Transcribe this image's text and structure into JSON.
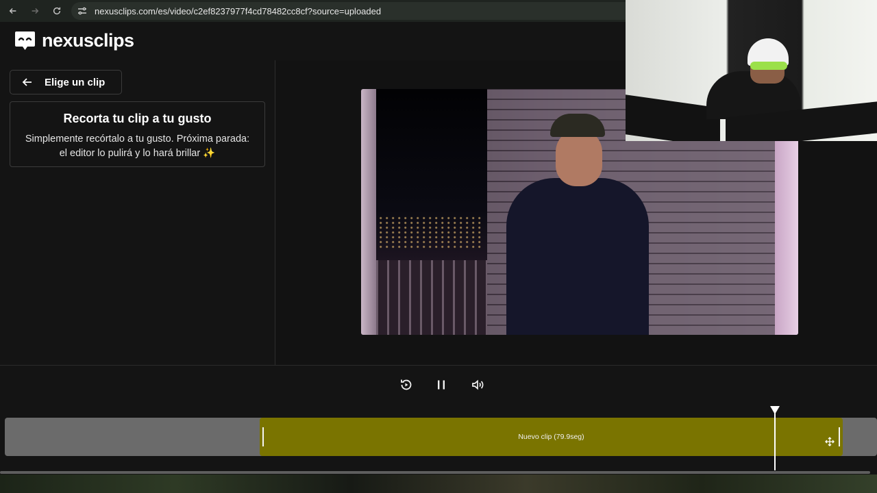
{
  "browser": {
    "url": "nexusclips.com/es/video/c2ef8237977f4cd78482cc8cf?source=uploaded"
  },
  "header": {
    "brand": "nexusclips"
  },
  "sidebar": {
    "back_label": "Elige un clip",
    "card_title": "Recorta tu clip a tu gusto",
    "card_text": "Simplemente recórtalo a tu gusto. Próxima parada: el editor lo pulirá y lo hará brillar ✨"
  },
  "timeline": {
    "clip_label": "Nuevo clip (79.9seg)"
  },
  "colors": {
    "clip": "#7a7400",
    "track": "#6b6b6b",
    "background": "#121212"
  }
}
